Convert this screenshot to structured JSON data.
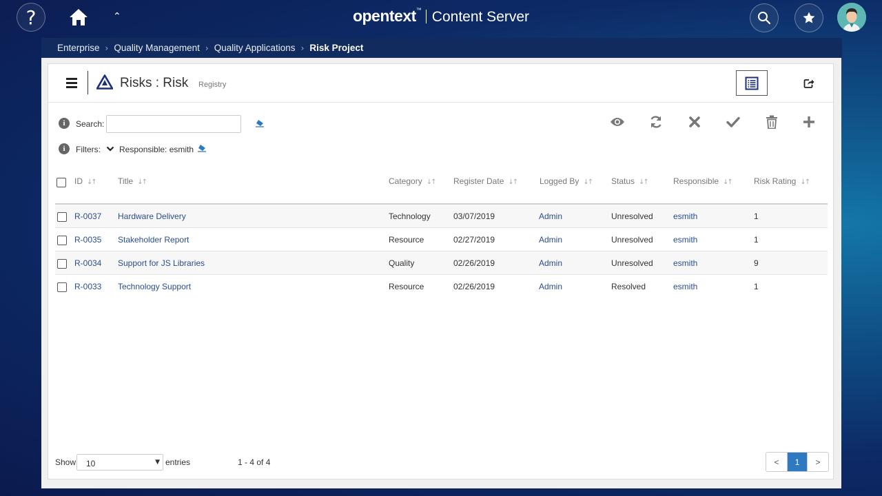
{
  "topbar": {
    "help_glyph": "?",
    "brand_bold": "opentext",
    "brand_tm": "™",
    "brand_product": "Content Server",
    "icons": [
      "help-icon",
      "home-icon",
      "caret-up-icon",
      "search-icon",
      "star-icon",
      "user-avatar"
    ]
  },
  "breadcrumb": {
    "items": [
      "Enterprise",
      "Quality Management",
      "Quality Applications"
    ],
    "current": "Risk Project"
  },
  "header": {
    "title": "Risks : Risk",
    "subtitle": "Registry"
  },
  "search": {
    "label": "Search:",
    "value": "",
    "placeholder": ""
  },
  "filters": {
    "label": "Filters:",
    "active": "Responsible: esmith"
  },
  "toolbar": [
    "view-icon",
    "refresh-icon",
    "close-icon",
    "check-icon",
    "trash-icon",
    "add-icon"
  ],
  "table": {
    "columns": [
      "ID",
      "Title",
      "Category",
      "Register Date",
      "Logged By",
      "Status",
      "Responsible",
      "Risk Rating"
    ],
    "rows": [
      {
        "id": "R-0037",
        "title": "Hardware Delivery",
        "category": "Technology",
        "date": "03/07/2019",
        "logged_by": "Admin",
        "status": "Unresolved",
        "responsible": "esmith",
        "rating": "1"
      },
      {
        "id": "R-0035",
        "title": "Stakeholder Report",
        "category": "Resource",
        "date": "02/27/2019",
        "logged_by": "Admin",
        "status": "Unresolved",
        "responsible": "esmith",
        "rating": "1"
      },
      {
        "id": "R-0034",
        "title": "Support for JS Libraries",
        "category": "Quality",
        "date": "02/26/2019",
        "logged_by": "Admin",
        "status": "Unresolved",
        "responsible": "esmith",
        "rating": "9"
      },
      {
        "id": "R-0033",
        "title": "Technology Support",
        "category": "Resource",
        "date": "02/26/2019",
        "logged_by": "Admin",
        "status": "Resolved",
        "responsible": "esmith",
        "rating": "1"
      }
    ]
  },
  "footer": {
    "show_label": "Show",
    "page_size": "10",
    "entries_label": "entries",
    "range": "1 - 4 of 4",
    "prev": "<",
    "current_page": "1",
    "next": ">"
  },
  "colors": {
    "accent": "#2f78c2",
    "link": "#2a4d8f",
    "breadcrumb_bg": "#122b5e"
  }
}
